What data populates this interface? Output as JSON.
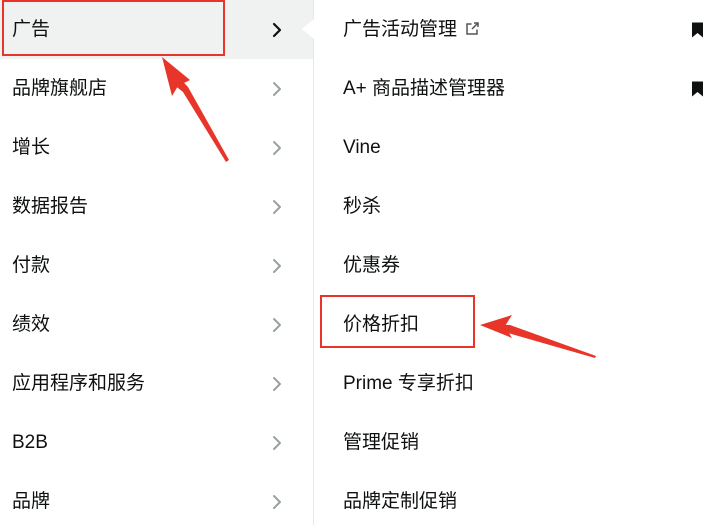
{
  "left_menu": {
    "items": [
      {
        "label": "广告",
        "active": true
      },
      {
        "label": "品牌旗舰店"
      },
      {
        "label": "增长"
      },
      {
        "label": "数据报告"
      },
      {
        "label": "付款"
      },
      {
        "label": "绩效"
      },
      {
        "label": "应用程序和服务"
      },
      {
        "label": "B2B"
      },
      {
        "label": "品牌"
      }
    ]
  },
  "right_menu": {
    "items": [
      {
        "label": "广告活动管理",
        "icon": "external-link-icon",
        "bookmarked": true
      },
      {
        "label": "A+ 商品描述管理器",
        "bookmarked": true
      },
      {
        "label": "Vine"
      },
      {
        "label": "秒杀"
      },
      {
        "label": "优惠券"
      },
      {
        "label": "价格折扣",
        "highlighted": true
      },
      {
        "label": "Prime 专享折扣"
      },
      {
        "label": "管理促销"
      },
      {
        "label": "品牌定制促销"
      }
    ]
  },
  "annotation_color": "#e8352a"
}
